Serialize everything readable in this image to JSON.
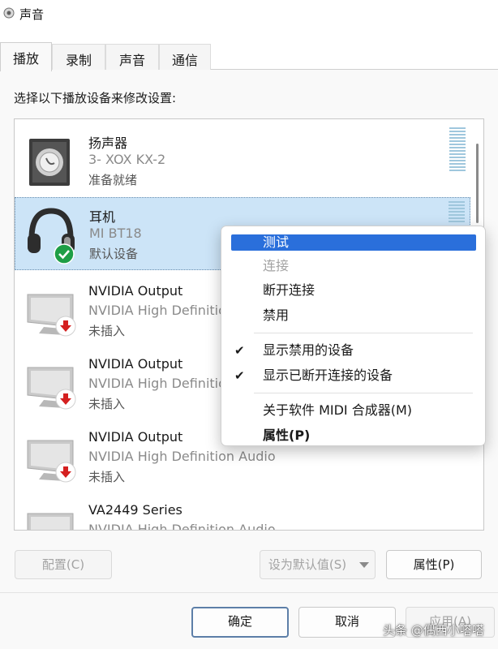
{
  "window": {
    "title": "声音",
    "icon": "speaker-icon"
  },
  "tabs": [
    {
      "label": "播放",
      "active": true
    },
    {
      "label": "录制"
    },
    {
      "label": "声音"
    },
    {
      "label": "通信"
    }
  ],
  "instruction": "选择以下播放设备来修改设置:",
  "devices": [
    {
      "name": "扬声器",
      "sub": "3- XOX KX-2",
      "status": "准备就绪",
      "icon": "speaker-device-icon"
    },
    {
      "name": "耳机",
      "sub": "MI BT18",
      "status": "默认设备",
      "icon": "headphones-icon",
      "badge": "default-check-icon",
      "selected": true
    },
    {
      "name": "NVIDIA Output",
      "sub": "NVIDIA High Definition Audio",
      "status": "未插入",
      "icon": "monitor-icon",
      "badge": "unplugged-arrow-icon"
    },
    {
      "name": "NVIDIA Output",
      "sub": "NVIDIA High Definition Audio",
      "status": "未插入",
      "icon": "monitor-icon",
      "badge": "unplugged-arrow-icon"
    },
    {
      "name": "NVIDIA Output",
      "sub": "NVIDIA High Definition Audio",
      "status": "未插入",
      "icon": "monitor-icon",
      "badge": "unplugged-arrow-icon"
    },
    {
      "name": "VA2449 Series",
      "sub": "NVIDIA High Definition Audio",
      "status": "",
      "icon": "monitor-icon"
    }
  ],
  "context_menu": {
    "items": [
      {
        "label": "测试",
        "highlighted": true
      },
      {
        "label": "连接",
        "disabled": true
      },
      {
        "label": "断开连接"
      },
      {
        "label": "禁用"
      },
      {
        "label": "显示禁用的设备",
        "checked": true
      },
      {
        "label": "显示已断开连接的设备",
        "checked": true
      },
      {
        "label": "关于软件 MIDI 合成器(M)"
      },
      {
        "label": "属性(P)",
        "bold": true
      }
    ]
  },
  "buttons": {
    "configure": "配置(C)",
    "set_default": "设为默认值(S)",
    "properties": "属性(P)",
    "ok": "确定",
    "cancel": "取消",
    "apply": "应用(A)"
  },
  "watermark": "头条 @偶西小嗒嗒",
  "colors": {
    "selection": "#cce4f7",
    "menu_highlight": "#2a6fdb",
    "check_badge": "#1e9e46",
    "unplug_badge": "#d42020"
  }
}
